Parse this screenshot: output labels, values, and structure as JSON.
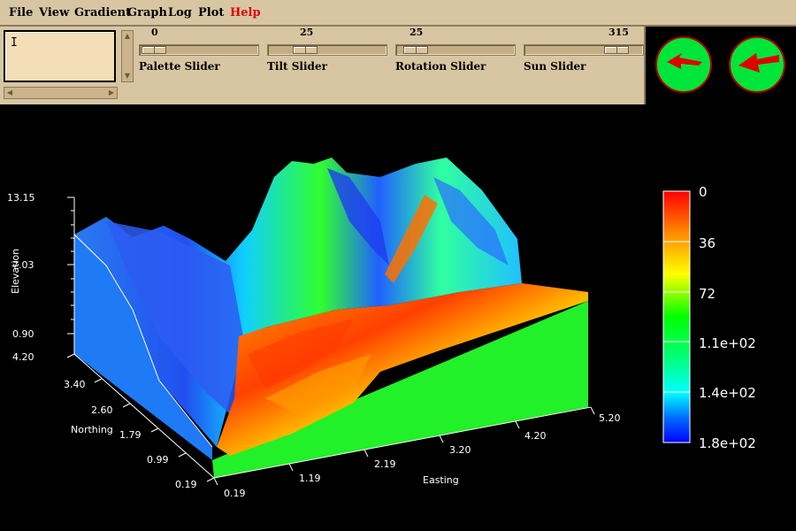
{
  "menu": {
    "items": [
      "File",
      "View",
      "Gradient",
      "Graph",
      "Log",
      "Plot",
      "Help"
    ]
  },
  "textbox": {
    "cursor": "I"
  },
  "sliders": [
    {
      "value": "0",
      "label": "Palette Slider"
    },
    {
      "value": "25",
      "label": "Tilt Slider"
    },
    {
      "value": "25",
      "label": "Rotation Slider"
    },
    {
      "value": "315",
      "label": "Sun Slider"
    }
  ],
  "compass": {
    "face_color": "#00e53a",
    "arrow_color": "#e00000",
    "icons": [
      "view-direction-icon",
      "sun-direction-icon"
    ]
  },
  "plot": {
    "elevation_label": "Elevation",
    "elevation_ticks": [
      "13.15",
      "7.03",
      "0.90"
    ],
    "northing_label": "Northing",
    "northing_ticks": [
      "4.20",
      "3.40",
      "2.60",
      "1.79",
      "0.99",
      "0.19"
    ],
    "easting_label": "Easting",
    "easting_ticks": [
      "0.19",
      "1.19",
      "2.19",
      "3.20",
      "4.20",
      "5.20"
    ]
  },
  "legend": {
    "labels": [
      "0",
      "36",
      "72",
      "1.1e+02",
      "1.4e+02",
      "1.8e+02"
    ],
    "colors": [
      "#ff0000",
      "#ff8c00",
      "#ffff00",
      "#00ff00",
      "#00ffff",
      "#0070ff",
      "#0000ff"
    ]
  }
}
